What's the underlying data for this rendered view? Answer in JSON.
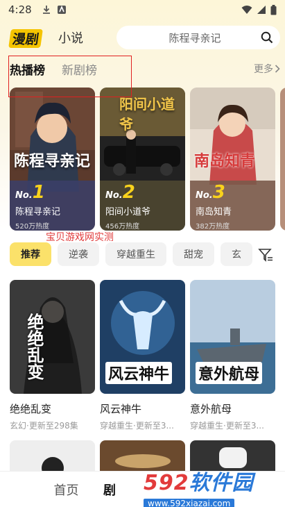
{
  "status_bar": {
    "time": "4:28"
  },
  "header": {
    "logo": "漫剧",
    "tab_novel": "小说",
    "search_placeholder": "陈程寻亲记"
  },
  "rank_tabs": {
    "hot": "热播榜",
    "new": "新剧榜",
    "more": "更多"
  },
  "rank_cards": [
    {
      "cover_title": "陈程寻亲记",
      "rank_prefix": "No.",
      "rank": "1",
      "name": "陈程寻亲记",
      "heat": "520万热度"
    },
    {
      "cover_title": "阳间小道爷",
      "rank_prefix": "No.",
      "rank": "2",
      "name": "阳间小道爷",
      "heat": "456万热度"
    },
    {
      "cover_title": "南岛知青",
      "rank_prefix": "No.",
      "rank": "3",
      "name": "南岛知青",
      "heat": "382万热度"
    }
  ],
  "watermark_red": "宝贝游戏网实测",
  "chips": [
    "推荐",
    "逆袭",
    "穿越重生",
    "甜宠",
    "玄"
  ],
  "grid": [
    {
      "cover_text": "绝绝乱变",
      "title": "绝绝乱变",
      "sub": "玄幻·更新至298集"
    },
    {
      "cover_text": "风云神牛",
      "title": "风云神牛",
      "sub": "穿越重生·更新至3..."
    },
    {
      "cover_text": "意外航母",
      "title": "意外航母",
      "sub": "穿越重生·更新至3..."
    }
  ],
  "bottom_nav": {
    "home": "首页",
    "drama": "剧"
  },
  "site_watermark": {
    "main_a": "592",
    "main_b": "软件园",
    "url": "www.592xiazai.com"
  },
  "colors": {
    "accent": "#fbe16a",
    "rank_gold": "#f9d21c",
    "highlight_box": "#e02020"
  }
}
